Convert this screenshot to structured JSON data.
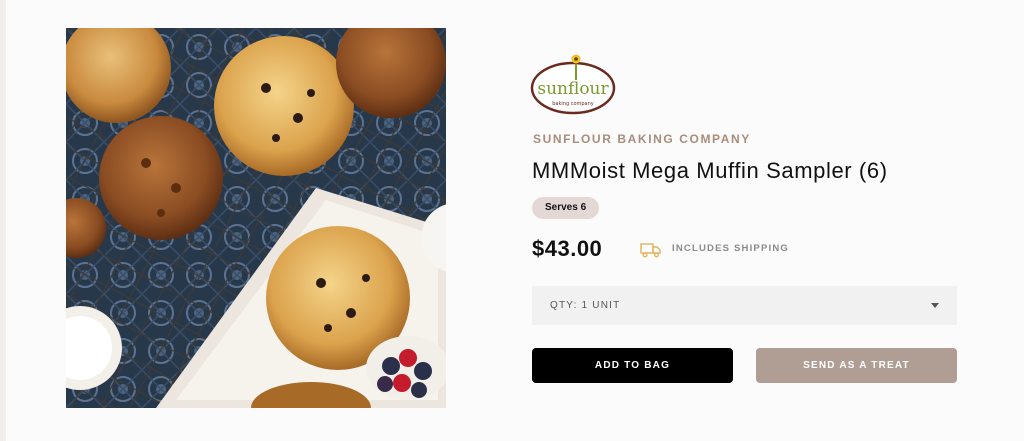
{
  "logo": {
    "word": "sunflour",
    "tagline": "baking company"
  },
  "product": {
    "brand": "SUNFLOUR BAKING COMPANY",
    "title": "MMMoist Mega Muffin Sampler (6)",
    "serves": "Serves 6",
    "price": "$43.00",
    "shipping_note": "INCLUDES SHIPPING",
    "shipping_icon": "truck-icon"
  },
  "quantity": {
    "selected": "QTY: 1 UNIT",
    "icon": "caret-down-icon"
  },
  "actions": {
    "add_to_bag": "ADD TO BAG",
    "send_as_treat": "SEND AS A TREAT"
  },
  "colors": {
    "brand_text": "#a88d7c",
    "badge_bg": "#e3d8d6",
    "primary_button": "#000000",
    "secondary_button": "#b09d93",
    "logo_ring": "#6b2a1e",
    "logo_word": "#7a9a2e",
    "shipping_icon": "#e0b35a"
  }
}
